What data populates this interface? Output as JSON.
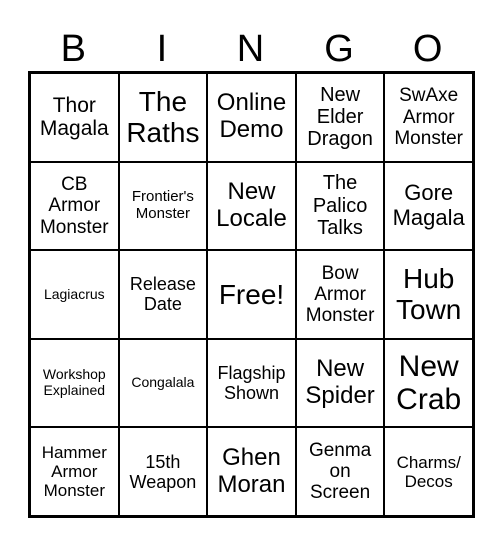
{
  "header": [
    "B",
    "I",
    "N",
    "G",
    "O"
  ],
  "cells": [
    "Thor\nMagala",
    "The\nRaths",
    "Online\nDemo",
    "New\nElder\nDragon",
    "SwAxe\nArmor\nMonster",
    "CB\nArmor\nMonster",
    "Frontier's\nMonster",
    "New\nLocale",
    "The\nPalico\nTalks",
    "Gore\nMagala",
    "Lagiacrus",
    "Release\nDate",
    "Free!",
    "Bow\nArmor\nMonster",
    "Hub\nTown",
    "Workshop\nExplained",
    "Congalala",
    "Flagship\nShown",
    "New\nSpider",
    "New\nCrab",
    "Hammer\nArmor\nMonster",
    "15th\nWeapon",
    "Ghen\nMoran",
    "Genma\non\nScreen",
    "Charms/\nDecos"
  ]
}
